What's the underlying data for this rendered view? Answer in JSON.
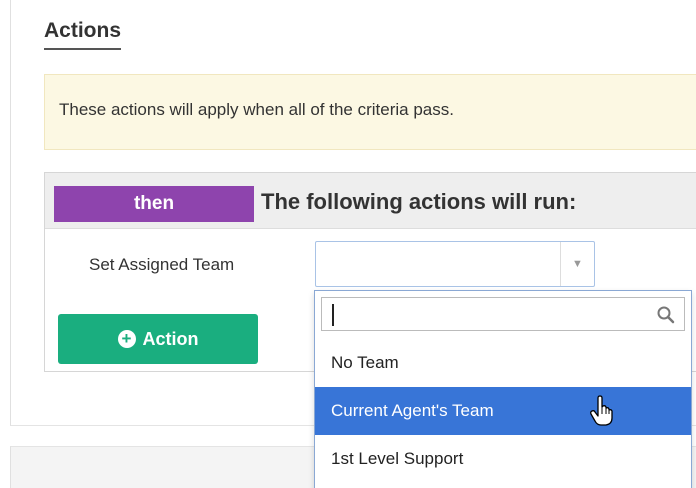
{
  "section": {
    "title": "Actions"
  },
  "notice": {
    "text": "These actions will apply when all of the criteria pass."
  },
  "action_block": {
    "badge": "then",
    "header": "The following actions will run:",
    "row": {
      "label": "Set Assigned Team",
      "selected_value": ""
    }
  },
  "buttons": {
    "add_action": "Action"
  },
  "dropdown": {
    "search_value": "",
    "options": [
      {
        "label": "No Team",
        "highlighted": false
      },
      {
        "label": "Current Agent's Team",
        "highlighted": true
      },
      {
        "label": "1st Level Support",
        "highlighted": false
      }
    ]
  },
  "colors": {
    "then_badge": "#8e44ad",
    "add_action_button": "#1aae7f",
    "notice_background": "#fcf8e3",
    "highlight": "#3875d7"
  },
  "icons": [
    "plus-circle-icon",
    "chevron-down-icon",
    "search-icon",
    "hand-pointer-icon"
  ]
}
